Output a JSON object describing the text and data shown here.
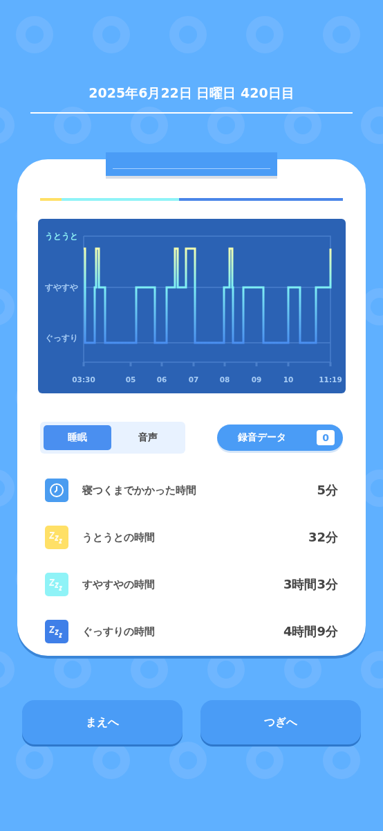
{
  "header": {
    "date": "2025年6月22日 日曜日 420日目"
  },
  "stage_bar": [
    {
      "color": "#ffe066",
      "level": 0.07
    },
    {
      "color": "#8ff3f7",
      "level": 0.46
    },
    {
      "color": "#4a86e8",
      "level": 1.0
    }
  ],
  "hypnogram": {
    "y_labels": [
      "うとうと",
      "すやすや",
      "ぐっすり"
    ],
    "x_labels": [
      "03:30",
      "05",
      "06",
      "07",
      "08",
      "09",
      "10",
      "11:19"
    ]
  },
  "tabs": [
    {
      "label": "睡眠",
      "selected": true
    },
    {
      "label": "音声",
      "selected": false
    }
  ],
  "recording": {
    "label": "録音データ",
    "count": "0"
  },
  "stats": [
    {
      "kind": "clock",
      "color": "#4a9cf0",
      "label": "寝つくまでかかった時間",
      "value": "5分"
    },
    {
      "kind": "sleep",
      "color": "#ffe066",
      "label": "うとうとの時間",
      "value": "32分"
    },
    {
      "kind": "sleep",
      "color": "#8ff3f7",
      "label": "すやすやの時間",
      "value": "3時間3分"
    },
    {
      "kind": "sleep",
      "color": "#3f7fe8",
      "label": "ぐっすりの時間",
      "value": "4時間9分"
    }
  ],
  "buttons": [
    "まえへ",
    "つぎへ"
  ]
}
